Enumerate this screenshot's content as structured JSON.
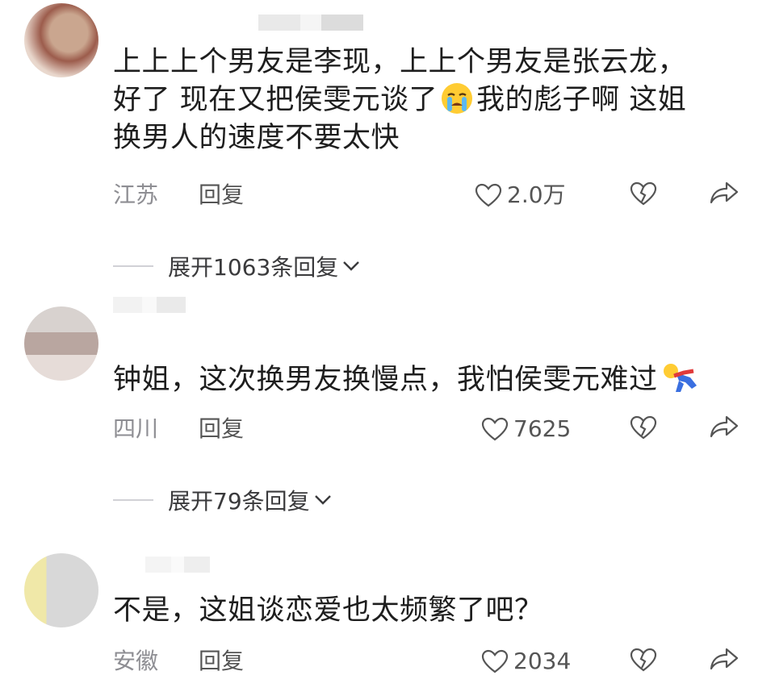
{
  "comments": [
    {
      "text_line1": "上上上个男友是李现，上上个男友是张云龙，",
      "text_line2a": "好了 现在又把侯雯元谈了",
      "text_line2b": "我的彪子啊 这姐",
      "text_line3": "换男人的速度不要太快",
      "location": "江苏",
      "reply_label": "回复",
      "likes": "2.0万",
      "expand_label": "展开1063条回复"
    },
    {
      "text": "钟姐，这次换男友换慢点，我怕侯雯元难过",
      "location": "四川",
      "reply_label": "回复",
      "likes": "7625",
      "expand_label": "展开79条回复"
    },
    {
      "text": "不是，这姐谈恋爱也太频繁了吧？",
      "location": "安徽",
      "reply_label": "回复",
      "likes": "2034"
    }
  ],
  "colors": {
    "text": "#1e1e1e",
    "meta": "#8e8e93",
    "divider": "#d1d1d6"
  }
}
